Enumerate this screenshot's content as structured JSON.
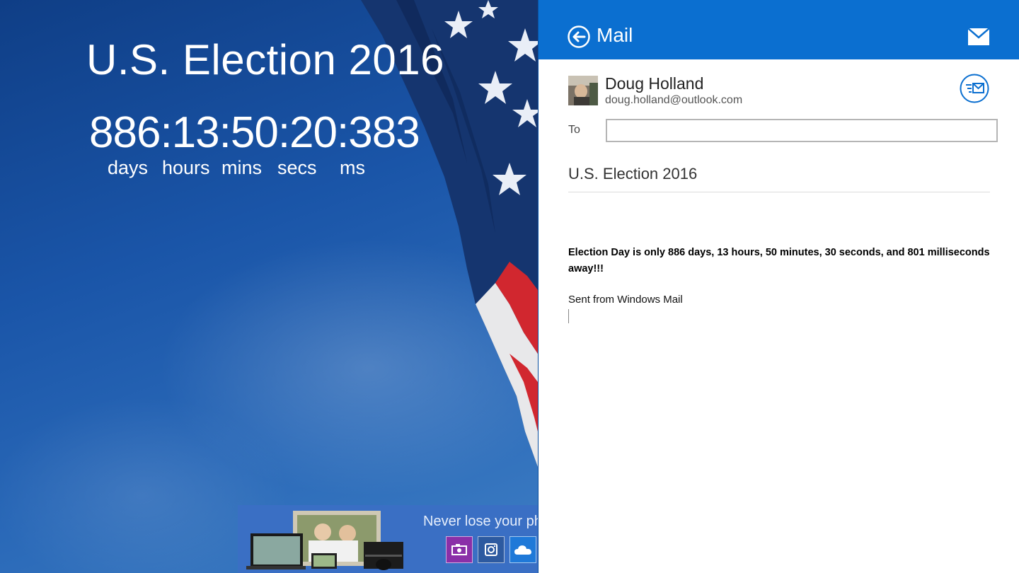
{
  "left_app": {
    "title": "U.S. Election 2016",
    "countdown": "886:13:50:20:383",
    "units": [
      "days",
      "hours",
      "mins",
      "secs",
      "ms"
    ],
    "ad": {
      "text": "Never lose your pho",
      "icons": [
        "camera-icon",
        "instagram-icon",
        "onedrive-icon"
      ]
    }
  },
  "mail": {
    "header_title": "Mail",
    "sender_name": "Doug Holland",
    "sender_email": "doug.holland@outlook.com",
    "to_label": "To",
    "to_value": "",
    "subject": "U.S. Election 2016",
    "body": "Election Day is only 886 days, 13 hours, 50 minutes, 30 seconds, and 801 milliseconds away!!!",
    "signature": "Sent from Windows Mail"
  },
  "colors": {
    "mail_header": "#0b6fd0",
    "sky": "#1a55a8",
    "flag_red": "#d1272f",
    "ad_background": "#3a6fc4"
  }
}
